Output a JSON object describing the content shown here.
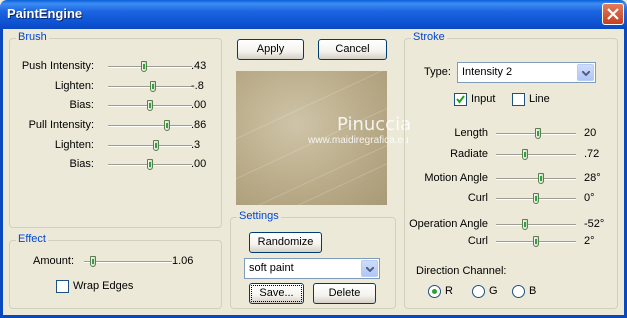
{
  "window": {
    "title": "PaintEngine"
  },
  "buttons": {
    "apply": "Apply",
    "cancel": "Cancel",
    "randomize": "Randomize",
    "save": "Save...",
    "delete": "Delete"
  },
  "brush": {
    "legend": "Brush",
    "rows": [
      {
        "label": "Push Intensity:",
        "value": ".43",
        "level": 0.43
      },
      {
        "label": "Lighten:",
        "value": "-.8",
        "level": 0.55
      },
      {
        "label": "Bias:",
        "value": ".00",
        "level": 0.5
      },
      {
        "label": "Pull Intensity:",
        "value": ".86",
        "level": 0.73
      },
      {
        "label": "Lighten:",
        "value": ".3",
        "level": 0.59
      },
      {
        "label": "Bias:",
        "value": ".00",
        "level": 0.5
      }
    ]
  },
  "effect": {
    "legend": "Effect",
    "amount_label": "Amount:",
    "amount_value": "1.06",
    "amount_level": 0.08,
    "wrap_edges": "Wrap Edges"
  },
  "settings": {
    "legend": "Settings",
    "preset": "soft paint"
  },
  "watermark": {
    "line1": "Pinuccia",
    "line2": "www.maidiregrafica.eu"
  },
  "stroke": {
    "legend": "Stroke",
    "type_label": "Type:",
    "type_value": "Intensity 2",
    "input_label": "Input",
    "input_checked": true,
    "line_label": "Line",
    "line_checked": false,
    "rows": [
      {
        "label": "Length",
        "value": "20",
        "level": 0.53
      },
      {
        "label": "Radiate",
        "value": ".72",
        "level": 0.35
      },
      {
        "label": "Motion Angle",
        "value": "28°",
        "level": 0.58
      },
      {
        "label": "Curl",
        "value": "0°",
        "level": 0.5
      },
      {
        "label": "Operation Angle",
        "value": "-52°",
        "level": 0.35
      },
      {
        "label": "Curl",
        "value": "2°",
        "level": 0.51
      }
    ],
    "direction_label": "Direction Channel:",
    "channels": [
      "R",
      "G",
      "B"
    ],
    "selected_channel": "R"
  }
}
